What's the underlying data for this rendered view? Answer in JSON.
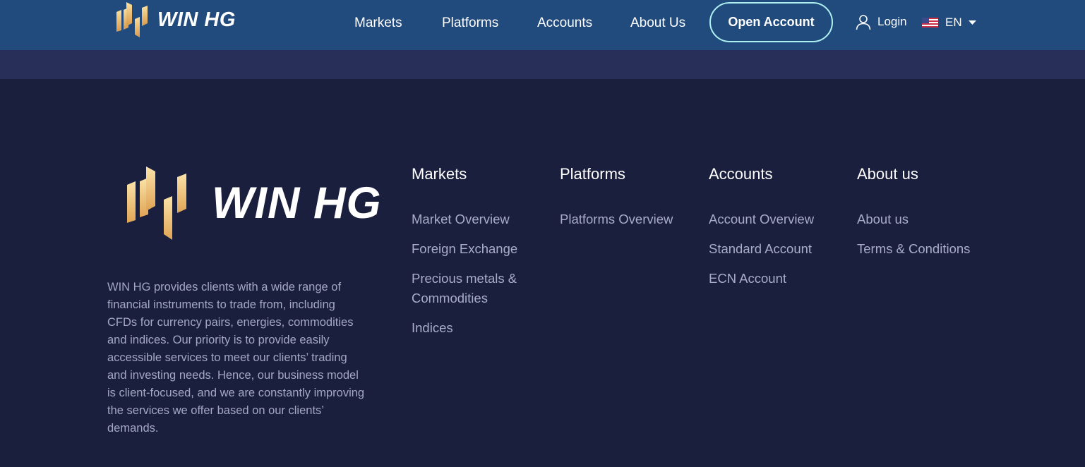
{
  "header": {
    "brand": "WIN HG",
    "nav": [
      "Markets",
      "Platforms",
      "Accounts",
      "About Us"
    ],
    "cta": "Open Account",
    "login": "Login",
    "language": "EN",
    "icons": [
      "win-hg-logo-icon",
      "user-icon",
      "us-flag-icon",
      "caret-down-icon"
    ],
    "colors": {
      "navbar": "#214a7d",
      "cta_border": "#aef0ef",
      "band": "#28305a"
    }
  },
  "footer": {
    "brand": "WIN HG",
    "description": "WIN HG provides clients with a wide range of financial instruments to trade from, including CFDs for currency pairs, energies, commodities and indices. Our priority is to provide easily accessible services to meet our clients’ trading and investing needs. Hence, our business model is client-focused, and we are constantly improving the services we offer based on our clients’ demands.",
    "columns": [
      {
        "title": "Markets",
        "links": [
          "Market Overview",
          "Foreign Exchange",
          "Precious metals & Commodities",
          "Indices"
        ]
      },
      {
        "title": "Platforms",
        "links": [
          "Platforms Overview"
        ]
      },
      {
        "title": "Accounts",
        "links": [
          "Account Overview",
          "Standard Account",
          "ECN Account"
        ]
      },
      {
        "title": "About us",
        "links": [
          "About us",
          "Terms & Conditions"
        ]
      }
    ],
    "colors": {
      "background": "#1b1f3e",
      "text": "#a3a8c3",
      "logo_gold": "#e8b45f"
    }
  }
}
